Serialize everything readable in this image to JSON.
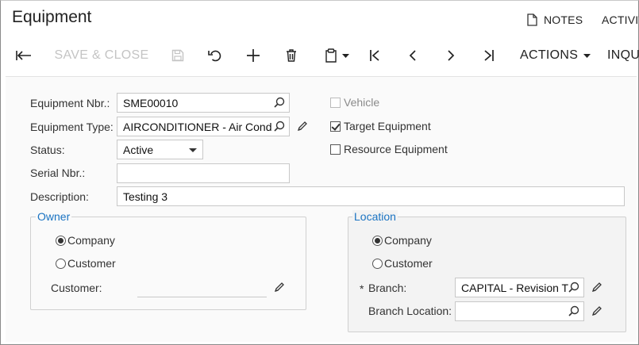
{
  "header": {
    "title": "Equipment",
    "notes_label": "NOTES",
    "activities_label": "ACTIVIT"
  },
  "toolbar": {
    "save_close_label": "SAVE & CLOSE",
    "actions_label": "ACTIONS",
    "inquiries_label": "INQU"
  },
  "form": {
    "equipment_nbr": {
      "label": "Equipment Nbr.:",
      "value": "SME00010"
    },
    "equipment_type": {
      "label": "Equipment Type:",
      "value": "AIRCONDITIONER - Air Cond"
    },
    "status": {
      "label": "Status:",
      "value": "Active"
    },
    "serial_nbr": {
      "label": "Serial Nbr.:",
      "value": ""
    },
    "description": {
      "label": "Description:",
      "value": "Testing 3"
    },
    "vehicle": {
      "label": "Vehicle",
      "checked": false,
      "disabled": true
    },
    "target_equipment": {
      "label": "Target Equipment",
      "checked": true
    },
    "resource_equipment": {
      "label": "Resource Equipment",
      "checked": false
    }
  },
  "owner": {
    "title": "Owner",
    "option_company": "Company",
    "option_customer": "Customer",
    "selected": "Company",
    "customer_label": "Customer:",
    "customer_value": ""
  },
  "location": {
    "title": "Location",
    "option_company": "Company",
    "option_customer": "Customer",
    "selected": "Company",
    "branch_required_mark": "*",
    "branch_label": "Branch:",
    "branch_value": "CAPITAL - Revision T",
    "branch_location_label": "Branch Location:",
    "branch_location_value": ""
  },
  "colors": {
    "group_title": "#1a73c2",
    "disabled_text": "#c4c4c4",
    "form_background": "#fafafa"
  }
}
